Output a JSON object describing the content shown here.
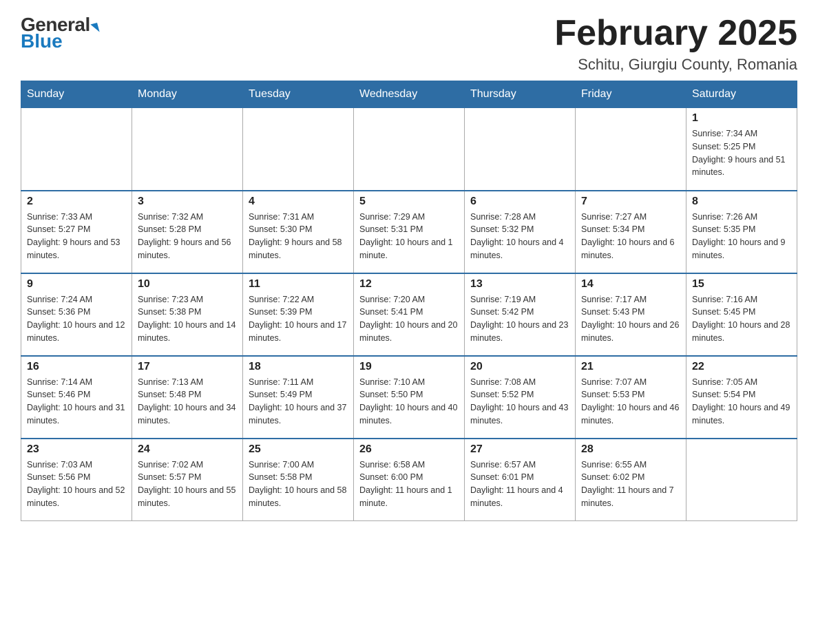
{
  "header": {
    "logo_general": "General",
    "logo_blue": "Blue",
    "month_title": "February 2025",
    "location": "Schitu, Giurgiu County, Romania"
  },
  "weekdays": [
    "Sunday",
    "Monday",
    "Tuesday",
    "Wednesday",
    "Thursday",
    "Friday",
    "Saturday"
  ],
  "weeks": [
    [
      {
        "day": "",
        "info": ""
      },
      {
        "day": "",
        "info": ""
      },
      {
        "day": "",
        "info": ""
      },
      {
        "day": "",
        "info": ""
      },
      {
        "day": "",
        "info": ""
      },
      {
        "day": "",
        "info": ""
      },
      {
        "day": "1",
        "info": "Sunrise: 7:34 AM\nSunset: 5:25 PM\nDaylight: 9 hours and 51 minutes."
      }
    ],
    [
      {
        "day": "2",
        "info": "Sunrise: 7:33 AM\nSunset: 5:27 PM\nDaylight: 9 hours and 53 minutes."
      },
      {
        "day": "3",
        "info": "Sunrise: 7:32 AM\nSunset: 5:28 PM\nDaylight: 9 hours and 56 minutes."
      },
      {
        "day": "4",
        "info": "Sunrise: 7:31 AM\nSunset: 5:30 PM\nDaylight: 9 hours and 58 minutes."
      },
      {
        "day": "5",
        "info": "Sunrise: 7:29 AM\nSunset: 5:31 PM\nDaylight: 10 hours and 1 minute."
      },
      {
        "day": "6",
        "info": "Sunrise: 7:28 AM\nSunset: 5:32 PM\nDaylight: 10 hours and 4 minutes."
      },
      {
        "day": "7",
        "info": "Sunrise: 7:27 AM\nSunset: 5:34 PM\nDaylight: 10 hours and 6 minutes."
      },
      {
        "day": "8",
        "info": "Sunrise: 7:26 AM\nSunset: 5:35 PM\nDaylight: 10 hours and 9 minutes."
      }
    ],
    [
      {
        "day": "9",
        "info": "Sunrise: 7:24 AM\nSunset: 5:36 PM\nDaylight: 10 hours and 12 minutes."
      },
      {
        "day": "10",
        "info": "Sunrise: 7:23 AM\nSunset: 5:38 PM\nDaylight: 10 hours and 14 minutes."
      },
      {
        "day": "11",
        "info": "Sunrise: 7:22 AM\nSunset: 5:39 PM\nDaylight: 10 hours and 17 minutes."
      },
      {
        "day": "12",
        "info": "Sunrise: 7:20 AM\nSunset: 5:41 PM\nDaylight: 10 hours and 20 minutes."
      },
      {
        "day": "13",
        "info": "Sunrise: 7:19 AM\nSunset: 5:42 PM\nDaylight: 10 hours and 23 minutes."
      },
      {
        "day": "14",
        "info": "Sunrise: 7:17 AM\nSunset: 5:43 PM\nDaylight: 10 hours and 26 minutes."
      },
      {
        "day": "15",
        "info": "Sunrise: 7:16 AM\nSunset: 5:45 PM\nDaylight: 10 hours and 28 minutes."
      }
    ],
    [
      {
        "day": "16",
        "info": "Sunrise: 7:14 AM\nSunset: 5:46 PM\nDaylight: 10 hours and 31 minutes."
      },
      {
        "day": "17",
        "info": "Sunrise: 7:13 AM\nSunset: 5:48 PM\nDaylight: 10 hours and 34 minutes."
      },
      {
        "day": "18",
        "info": "Sunrise: 7:11 AM\nSunset: 5:49 PM\nDaylight: 10 hours and 37 minutes."
      },
      {
        "day": "19",
        "info": "Sunrise: 7:10 AM\nSunset: 5:50 PM\nDaylight: 10 hours and 40 minutes."
      },
      {
        "day": "20",
        "info": "Sunrise: 7:08 AM\nSunset: 5:52 PM\nDaylight: 10 hours and 43 minutes."
      },
      {
        "day": "21",
        "info": "Sunrise: 7:07 AM\nSunset: 5:53 PM\nDaylight: 10 hours and 46 minutes."
      },
      {
        "day": "22",
        "info": "Sunrise: 7:05 AM\nSunset: 5:54 PM\nDaylight: 10 hours and 49 minutes."
      }
    ],
    [
      {
        "day": "23",
        "info": "Sunrise: 7:03 AM\nSunset: 5:56 PM\nDaylight: 10 hours and 52 minutes."
      },
      {
        "day": "24",
        "info": "Sunrise: 7:02 AM\nSunset: 5:57 PM\nDaylight: 10 hours and 55 minutes."
      },
      {
        "day": "25",
        "info": "Sunrise: 7:00 AM\nSunset: 5:58 PM\nDaylight: 10 hours and 58 minutes."
      },
      {
        "day": "26",
        "info": "Sunrise: 6:58 AM\nSunset: 6:00 PM\nDaylight: 11 hours and 1 minute."
      },
      {
        "day": "27",
        "info": "Sunrise: 6:57 AM\nSunset: 6:01 PM\nDaylight: 11 hours and 4 minutes."
      },
      {
        "day": "28",
        "info": "Sunrise: 6:55 AM\nSunset: 6:02 PM\nDaylight: 11 hours and 7 minutes."
      },
      {
        "day": "",
        "info": ""
      }
    ]
  ]
}
